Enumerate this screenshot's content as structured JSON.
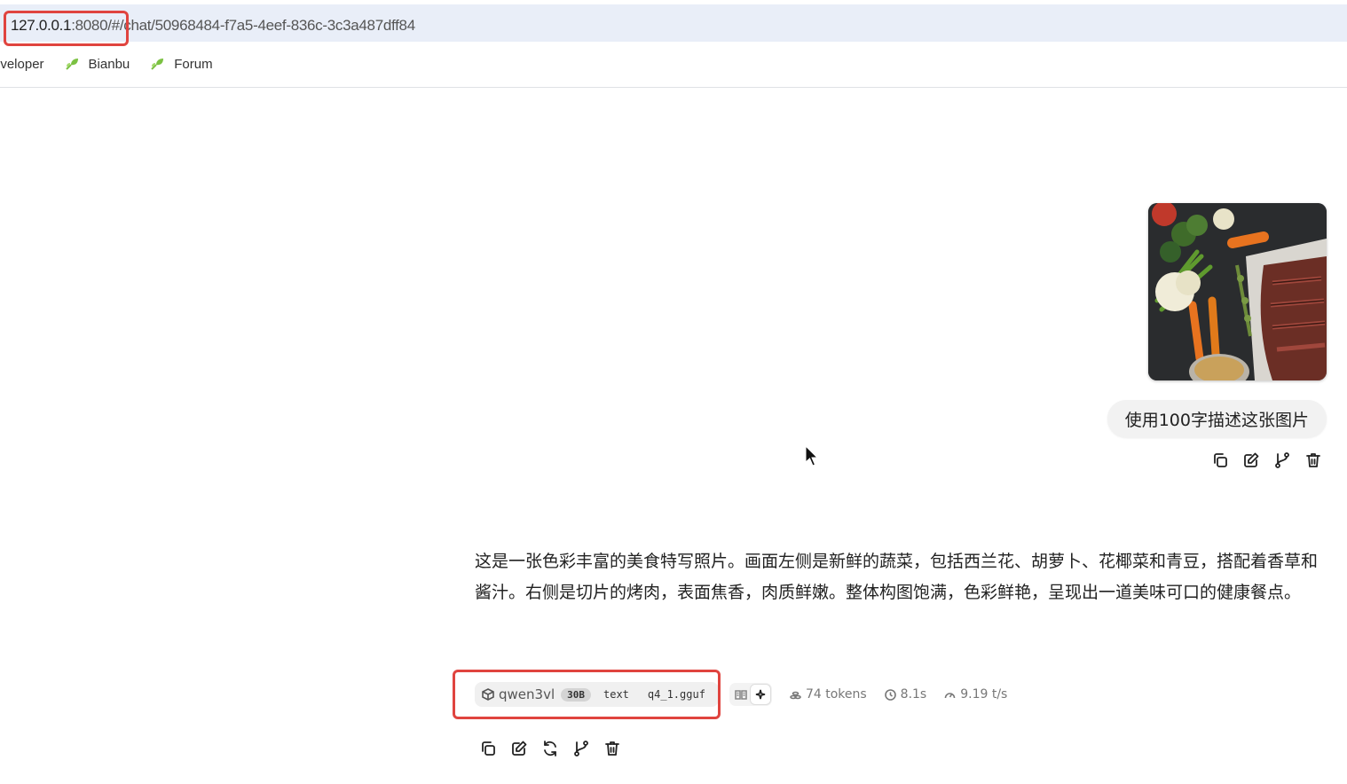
{
  "browser": {
    "url_host": "127.0.0.1",
    "url_port": ":8080/",
    "url_rest": "#/chat/50968484-f7a5-4eef-836c-3c3a487dff84",
    "bookmarks": [
      "eveloper",
      "Bianbu",
      "Forum"
    ]
  },
  "colors": {
    "highlight": "#e0443f",
    "urlbar_bg": "#e9eef8",
    "bookmark_icon": "#7bc142"
  },
  "user_message": {
    "text": "使用100字描述这张图片",
    "image_alt": "food-photo-steak-vegetables",
    "actions": [
      "copy-icon",
      "edit-icon",
      "branch-icon",
      "delete-icon"
    ]
  },
  "assistant_message": {
    "text": "这是一张色彩丰富的美食特写照片。画面左侧是新鲜的蔬菜，包括西兰花、胡萝卜、花椰菜和青豆，搭配着香草和酱汁。右侧是切片的烤肉，表面焦香，肉质鲜嫩。整体构图饱满，色彩鲜艳，呈现出一道美味可口的健康餐点。",
    "model": {
      "name": "qwen3vl",
      "params": "30B",
      "modality": "text",
      "quant": "q4_1.gguf"
    },
    "stats": {
      "tokens": "74 tokens",
      "time": "8.1s",
      "speed": "9.19 t/s"
    },
    "actions": [
      "copy-icon",
      "edit-icon",
      "regenerate-icon",
      "branch-icon",
      "delete-icon"
    ]
  }
}
